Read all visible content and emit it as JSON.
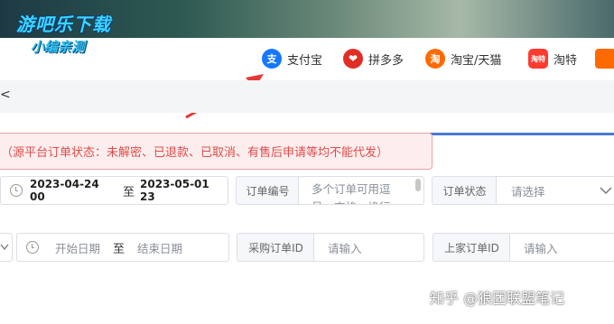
{
  "watermark": {
    "top": "游吧乐下载",
    "sub": "小编亲测",
    "bottom": "知乎 @狼团联盟笔记"
  },
  "platforms": [
    {
      "icon": "alipay-icon",
      "icon_text": "支",
      "color": "#1677ff",
      "label": "支付宝"
    },
    {
      "icon": "pinduoduo-icon",
      "icon_text": "❤",
      "color": "#e02e24",
      "label": "拼多多"
    },
    {
      "icon": "taobao-icon",
      "icon_text": "淘",
      "color": "#ff6a00",
      "label": "淘宝/天猫"
    },
    {
      "icon": "taote-icon",
      "icon_text": "淘特",
      "color": "#ff3b30",
      "label": "淘特"
    }
  ],
  "nav": {
    "back_glyph": "<"
  },
  "alert": {
    "text": "（源平台订单状态：未解密、已退款、已取消、有售后申请等均不能代发）"
  },
  "filters": {
    "date_range": {
      "start": "2023-04-24 00",
      "sep": "至",
      "end": "2023-05-01 23"
    },
    "order_no": {
      "label": "订单编号",
      "placeholder": "多个订单可用逗号、空格、换行"
    },
    "order_status": {
      "label": "订单状态",
      "placeholder": "请选择"
    },
    "date_range2": {
      "start_placeholder": "开始日期",
      "sep": "至",
      "end_placeholder": "结束日期"
    },
    "purchase_id": {
      "label": "采购订单ID",
      "placeholder": "请输入"
    },
    "seller_id": {
      "label": "上家订单ID",
      "placeholder": "请输入"
    }
  },
  "colors": {
    "accent": "#4a78d6",
    "alert_text": "#e04b4b",
    "annotation_arrow": "#e53935"
  }
}
